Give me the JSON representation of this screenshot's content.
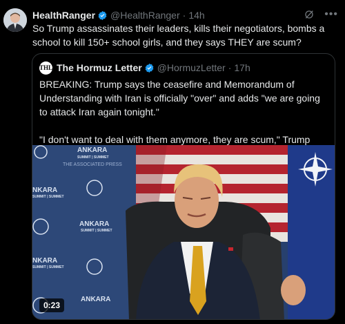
{
  "post": {
    "display_name": "HealthRanger",
    "handle": "@HealthRanger",
    "separator": "·",
    "time": "14h",
    "text": "So Trump assassinates their leaders, kills their negotiators, bombs a school to kill 150+ school girls, and they says THEY are scum?",
    "more_icon": "more-horizontal-icon",
    "grok_icon": "grok-icon"
  },
  "quote": {
    "avatar_text": "THL",
    "display_name": "The Hormuz Letter",
    "handle": "@HormuzLetter",
    "separator": "·",
    "time": "17h",
    "paragraph1": "BREAKING: Trump says the ceasefire and Memorandum of Understanding with Iran is officially \"over\" and adds \"we are going to attack Iran again tonight.\"",
    "paragraph2": "\"I don't want to deal with them anymore, they are scum,\" Trump says."
  },
  "video": {
    "duration": "0:23",
    "backdrop_words": [
      "ANKARA",
      "SUMMIT | SUMMET",
      "THE ASSOCIATED PRESS",
      "NKARA"
    ]
  },
  "colors": {
    "background": "#000000",
    "text": "#e7e9ea",
    "muted": "#71767b",
    "border": "#2f3336",
    "verified": "#1d9bf0"
  }
}
